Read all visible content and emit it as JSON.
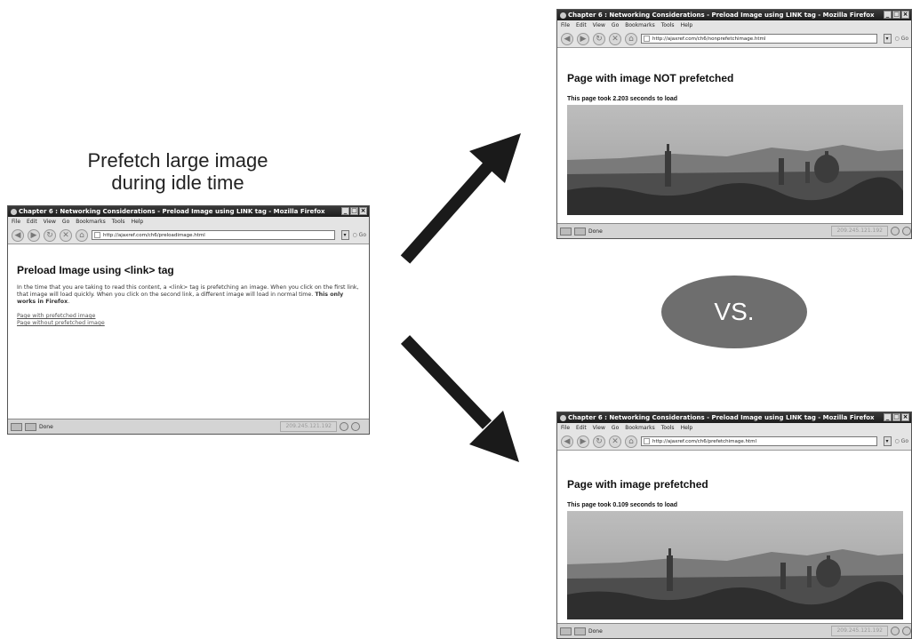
{
  "caption": {
    "line1": "Prefetch large image",
    "line2": "during idle time"
  },
  "vs_label": "VS.",
  "browser_menu": [
    "File",
    "Edit",
    "View",
    "Go",
    "Bookmarks",
    "Tools",
    "Help"
  ],
  "window_title": "Chapter 6 : Networking Considerations - Preload Image using LINK tag - Mozilla Firefox",
  "status_text": "Done",
  "status_ip": "209.245.121.192",
  "go_label": "Go",
  "left_window": {
    "url": "http://ajaxref.com/ch6/preloadimage.html",
    "heading": "Preload Image using <link> tag",
    "paragraph": "In the time that you are taking to read this content, a <link> tag is prefetching an image. When you click on the first link, that image will load quickly. When you click on the second link, a different image will load in normal time.",
    "paragraph_bold": "This only works in Firefox",
    "links": [
      "Page with prefetched image",
      "Page without prefetched image"
    ]
  },
  "top_right_window": {
    "url": "http://ajaxref.com/ch6/nonprefetchimage.html",
    "heading": "Page with image NOT prefetched",
    "load_text": "This page took 2.203 seconds to load"
  },
  "bottom_right_window": {
    "url": "http://ajaxref.com/ch6/prefetchimage.html",
    "heading": "Page with image prefetched",
    "load_text": "This page took 0.109 seconds to load"
  },
  "colors": {
    "arrow": "#1a1a1a",
    "vs_oval": "#6e6e6e",
    "titlebar": "#2a2a2a"
  }
}
